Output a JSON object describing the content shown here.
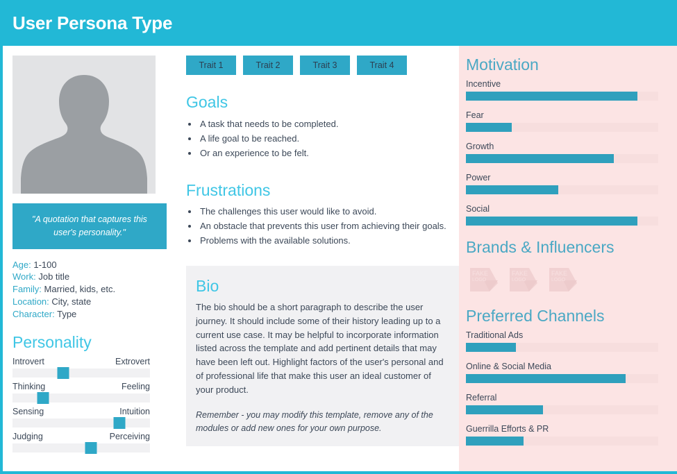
{
  "header": {
    "title": "User Persona Type"
  },
  "profile": {
    "avatar_alt": "user-avatar-placeholder",
    "quote": "\"A quotation that captures this user's personality.\"",
    "demographics": [
      {
        "key": "Age:",
        "value": "1-100"
      },
      {
        "key": "Work:",
        "value": "Job title"
      },
      {
        "key": "Family:",
        "value": "Married, kids, etc."
      },
      {
        "key": "Location:",
        "value": "City, state"
      },
      {
        "key": "Character:",
        "value": "Type"
      }
    ]
  },
  "personality": {
    "title": "Personality",
    "sliders": [
      {
        "left": "Introvert",
        "right": "Extrovert",
        "value": 37
      },
      {
        "left": "Thinking",
        "right": "Feeling",
        "value": 22
      },
      {
        "left": "Sensing",
        "right": "Intuition",
        "value": 78
      },
      {
        "left": "Judging",
        "right": "Perceiving",
        "value": 57
      }
    ]
  },
  "traits": [
    "Trait 1",
    "Trait 2",
    "Trait 3",
    "Trait 4"
  ],
  "goals": {
    "title": "Goals",
    "items": [
      "A task that needs to be completed.",
      "A life goal to be reached.",
      "Or an experience to be felt."
    ]
  },
  "frustrations": {
    "title": "Frustrations",
    "items": [
      "The challenges this user would like to avoid.",
      "An obstacle that prevents this user from achieving their goals.",
      "Problems with the available solutions."
    ]
  },
  "bio": {
    "title": "Bio",
    "text": "The bio should be a short paragraph to describe the user journey. It should include some of their history leading up to a current use case. It may be helpful to incorporate information listed across the template and add pertinent details that may have been left out. Highlight factors of the user's personal and of professional life that make this user an ideal customer of your product.",
    "note": "Remember - you may modify this template, remove any of the modules or add new ones for your own purpose."
  },
  "motivation": {
    "title": "Motivation",
    "bars": [
      {
        "label": "Incentive",
        "value": 89
      },
      {
        "label": "Fear",
        "value": 24
      },
      {
        "label": "Growth",
        "value": 77
      },
      {
        "label": "Power",
        "value": 48
      },
      {
        "label": "Social",
        "value": 89
      }
    ]
  },
  "brands": {
    "title": "Brands & Influencers",
    "logos": [
      "FAKE LOGO",
      "FAKE LOGO",
      "FAKE LOGO"
    ]
  },
  "channels": {
    "title": "Preferred Channels",
    "bars": [
      {
        "label": "Traditional Ads",
        "value": 26
      },
      {
        "label": "Online & Social Media",
        "value": 83
      },
      {
        "label": "Referral",
        "value": 40
      },
      {
        "label": "Guerrilla Efforts & PR",
        "value": 30
      }
    ]
  },
  "colors": {
    "header_teal": "#22b8d6",
    "accent_teal": "#2fa8c7",
    "bar_teal": "#2fa0bd",
    "panel_pink": "#fce4e4",
    "track_pink": "#f7dede",
    "track_gray": "#f1f1f3",
    "heading_cyan": "#3fc6e5",
    "heading_panel": "#4aa8c4",
    "text_dark": "#3c4858"
  }
}
